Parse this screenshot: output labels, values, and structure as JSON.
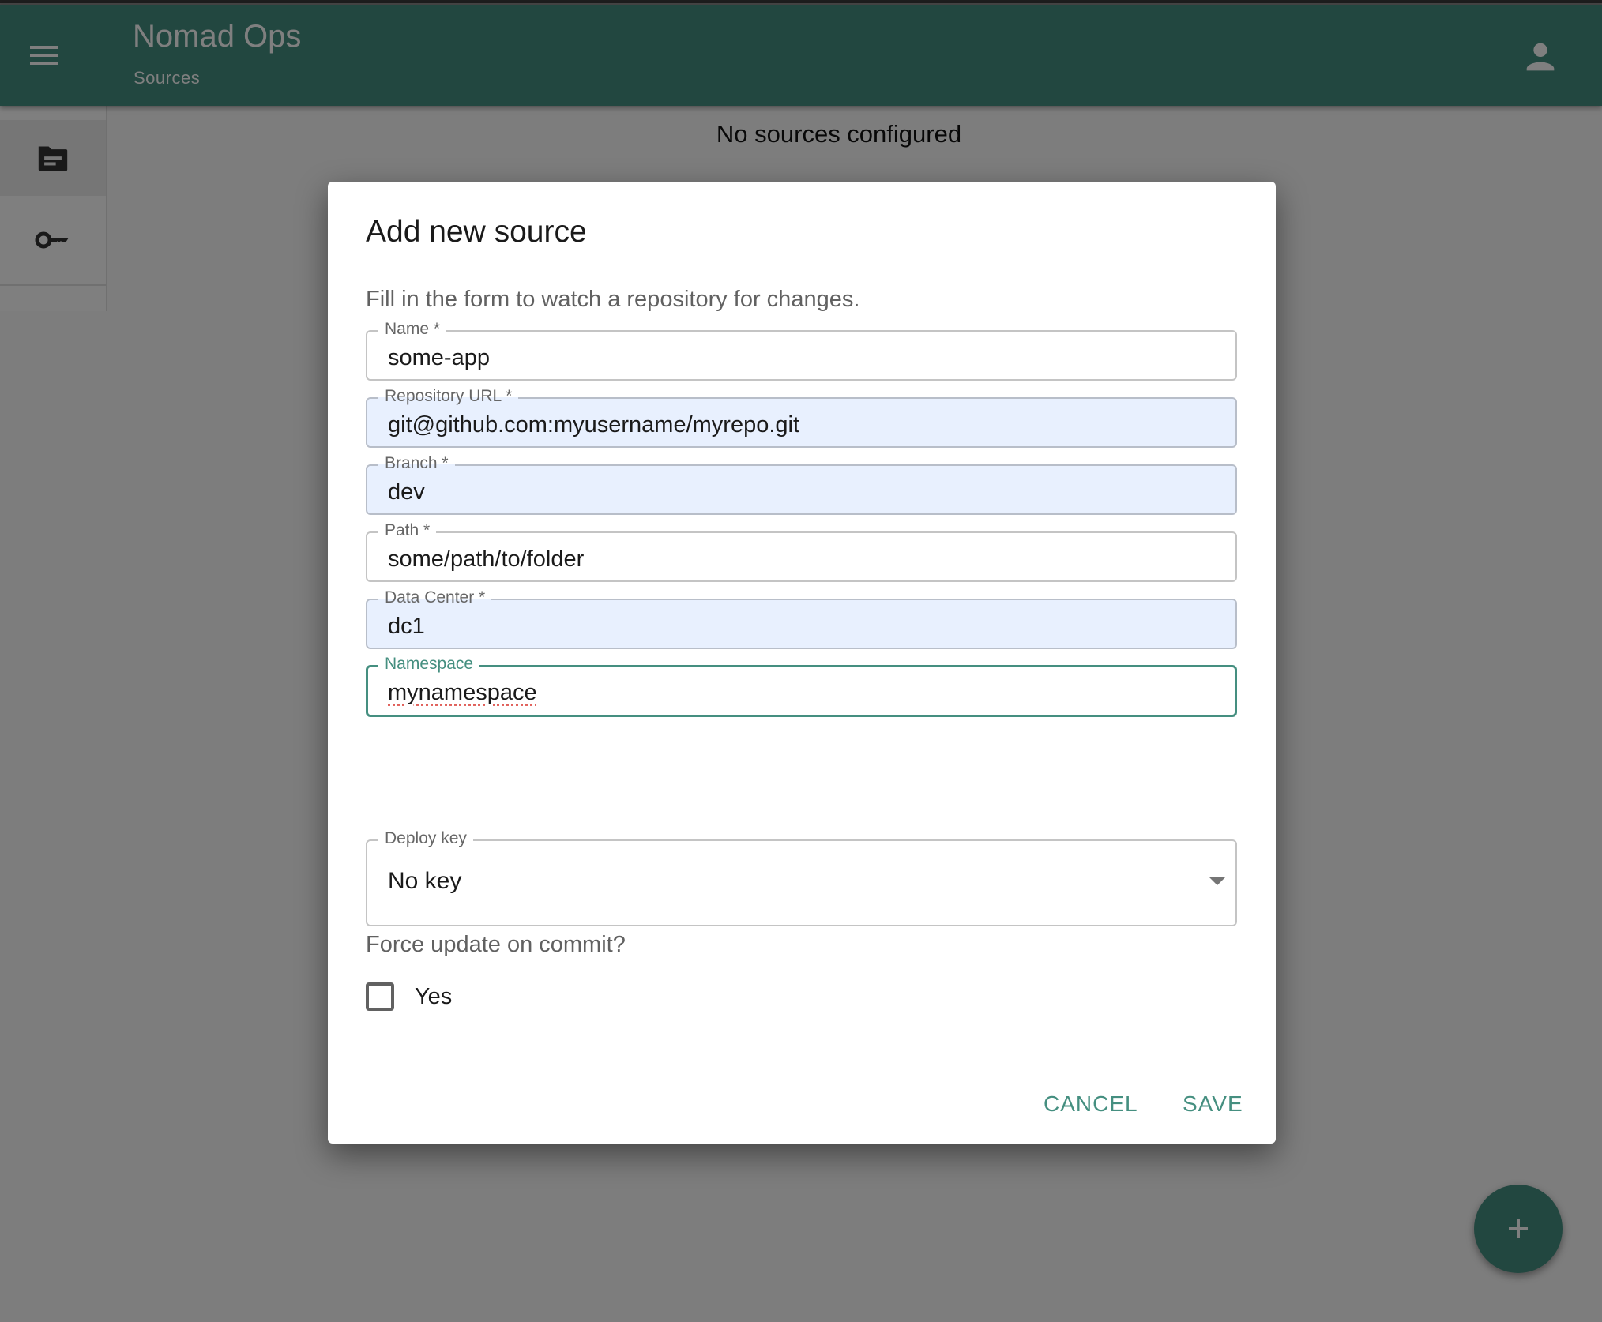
{
  "app": {
    "title": "Nomad Ops",
    "subtitle": "Sources",
    "menu_icon": "hamburger-menu-icon",
    "account_icon": "account-icon",
    "brand_color": "#458f80"
  },
  "sidebar": {
    "items": [
      {
        "icon": "folder-icon",
        "label": "Sources",
        "selected": true
      },
      {
        "icon": "key-icon",
        "label": "Keys",
        "selected": false
      }
    ]
  },
  "main": {
    "empty_message": "No sources configured",
    "fab_icon": "plus-icon"
  },
  "dialog": {
    "title": "Add new source",
    "subtitle": "Fill in the form to watch a repository for changes.",
    "fields": [
      {
        "label": "Name *",
        "value": "some-app"
      },
      {
        "label": "Repository URL *",
        "value": "git@github.com:myusername/myrepo.git"
      },
      {
        "label": "Branch *",
        "value": "dev"
      },
      {
        "label": "Path *",
        "value": "some/path/to/folder"
      },
      {
        "label": "Data Center *",
        "value": "dc1"
      },
      {
        "label": "Namespace",
        "value": "mynamespace"
      }
    ],
    "deploy_key": {
      "label": "Deploy key",
      "selected": "No key"
    },
    "force_update": {
      "question": "Force update on commit?",
      "checkbox_label": "Yes",
      "checked": false
    },
    "actions": {
      "cancel": "CANCEL",
      "save": "SAVE"
    }
  }
}
